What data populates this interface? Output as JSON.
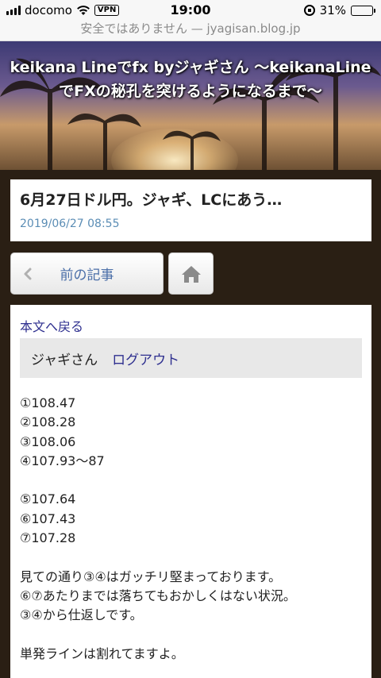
{
  "status_bar": {
    "carrier": "docomo",
    "vpn": "VPN",
    "time": "19:00",
    "battery_percent": "31%",
    "battery_level": 0.31
  },
  "url_bar": {
    "text": "安全ではありません — jyagisan.blog.jp"
  },
  "header": {
    "title": "keikana Lineでfx byジャギさん 〜keikanaLineでFXの秘孔を突けるようになるまで〜"
  },
  "post": {
    "title": "6月27日ドル円。ジャギ、LCにあう…",
    "date": "2019/06/27 08:55"
  },
  "nav": {
    "prev_label": "前の記事"
  },
  "article": {
    "back_link": "本文へ戻る",
    "user_name": "ジャギさん",
    "logout": "ログアウト",
    "lines": [
      "①108.47",
      "②108.28",
      "③108.06",
      "④107.93〜87",
      "",
      "⑤107.64",
      "⑥107.43",
      "⑦107.28",
      "",
      "見ての通り③④はガッチリ堅まっております。",
      "⑥⑦あたりまでは落ちてもおかしくはない状況。",
      "③④から仕返しです。",
      "",
      "単発ラインは割れてますよ。"
    ]
  },
  "colors": {
    "link": "#2e2f8f",
    "date": "#5b8db5",
    "page_bg": "#2a1f14"
  }
}
